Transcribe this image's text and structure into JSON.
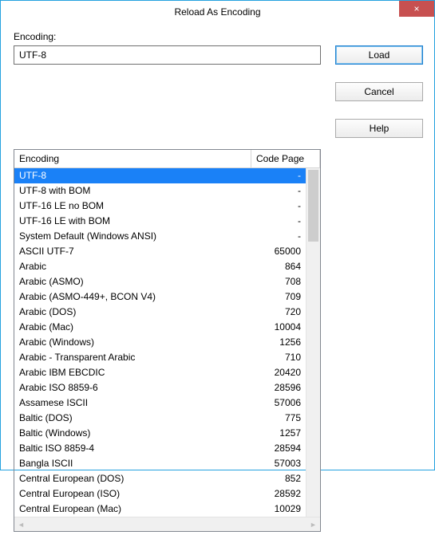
{
  "window": {
    "title": "Reload As Encoding"
  },
  "labels": {
    "encoding": "Encoding:"
  },
  "input": {
    "value": "UTF-8"
  },
  "buttons": {
    "load": "Load",
    "cancel": "Cancel",
    "help": "Help",
    "close_glyph": "×"
  },
  "columns": {
    "encoding": "Encoding",
    "codepage": "Code Page"
  },
  "selected_index": 0,
  "rows": [
    {
      "name": "UTF-8",
      "cp": "-"
    },
    {
      "name": "UTF-8 with BOM",
      "cp": "-"
    },
    {
      "name": "UTF-16 LE no BOM",
      "cp": "-"
    },
    {
      "name": "UTF-16 LE with BOM",
      "cp": "-"
    },
    {
      "name": "System Default (Windows ANSI)",
      "cp": "-"
    },
    {
      "name": "ASCII UTF-7",
      "cp": "65000"
    },
    {
      "name": "Arabic",
      "cp": "864"
    },
    {
      "name": "Arabic (ASMO)",
      "cp": "708"
    },
    {
      "name": "Arabic (ASMO-449+, BCON V4)",
      "cp": "709"
    },
    {
      "name": "Arabic (DOS)",
      "cp": "720"
    },
    {
      "name": "Arabic (Mac)",
      "cp": "10004"
    },
    {
      "name": "Arabic (Windows)",
      "cp": "1256"
    },
    {
      "name": "Arabic - Transparent Arabic",
      "cp": "710"
    },
    {
      "name": "Arabic IBM EBCDIC",
      "cp": "20420"
    },
    {
      "name": "Arabic ISO 8859-6",
      "cp": "28596"
    },
    {
      "name": "Assamese ISCII",
      "cp": "57006"
    },
    {
      "name": "Baltic (DOS)",
      "cp": "775"
    },
    {
      "name": "Baltic (Windows)",
      "cp": "1257"
    },
    {
      "name": "Baltic ISO 8859-4",
      "cp": "28594"
    },
    {
      "name": "Bangla ISCII",
      "cp": "57003"
    },
    {
      "name": "Central European (DOS)",
      "cp": "852"
    },
    {
      "name": "Central European (ISO)",
      "cp": "28592"
    },
    {
      "name": "Central European (Mac)",
      "cp": "10029"
    }
  ]
}
